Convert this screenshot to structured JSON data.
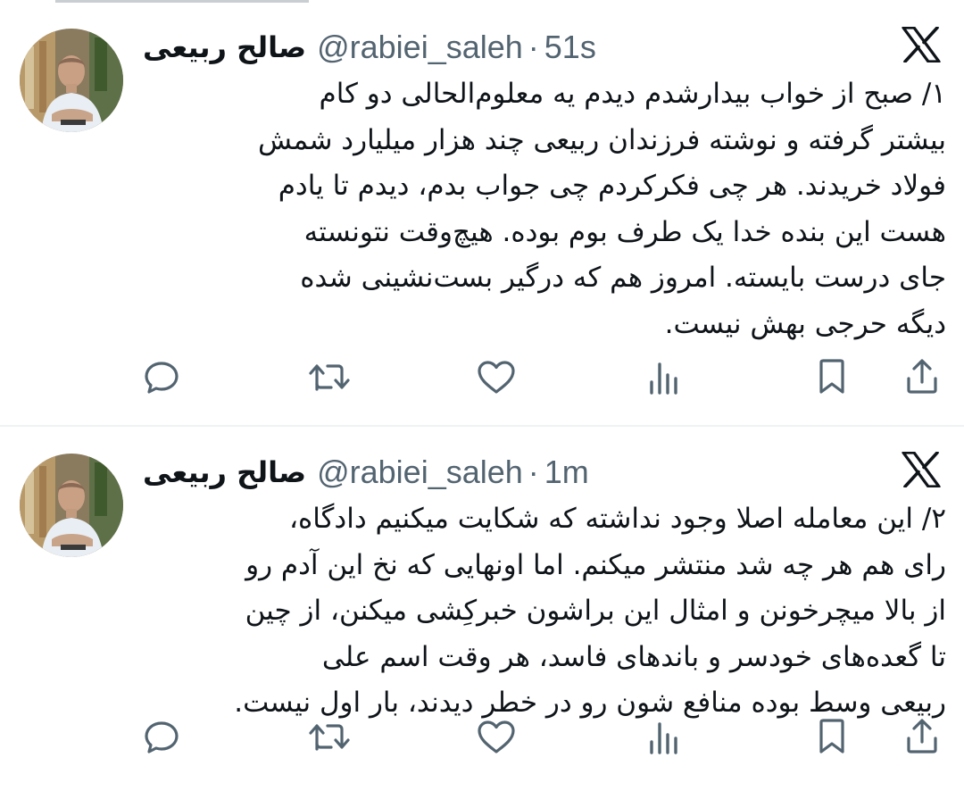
{
  "theme": {
    "text_color": "#0f1419",
    "muted_color": "#536471",
    "divider_color": "#eff3f4"
  },
  "tweets": [
    {
      "name": "صالح ربیعی",
      "handle": "@rabiei_saleh",
      "separator": "·",
      "time": "51s",
      "lines": [
        "۱/ صبح از خواب بیدارشدم دیدم یه معلوم‌الحالی دو کام",
        "بیشتر گرفته و نوشته فرزندان ربیعی چند هزار میلیارد شمش",
        "فولاد خریدند. هر چی فکرکردم چی جواب بدم، دیدم تا یادم",
        "هست این بنده خدا یک طرف بوم بوده. هیچ‌وقت نتونسته",
        "جای درست بایسته. امروز هم که درگیر بست‌نشینی شده",
        "دیگه حرجی بهش نیست."
      ]
    },
    {
      "name": "صالح ربیعی",
      "handle": "@rabiei_saleh",
      "separator": "·",
      "time": "1m",
      "lines": [
        "۲/ این معامله اصلا وجود نداشته که شکایت میکنیم دادگاه،",
        "رای هم هر چه شد منتشر میکنم. اما اونهایی که نخ این آدم رو",
        "از بالا میچرخونن و امثال این براشون خبرکِشی میکنن، از چین",
        "تا گعده‌های خودسر و باندهای فاسد، هر وقت اسم علی",
        "ربیعی وسط بوده منافع شون رو در خطر دیدند، بار اول نیست."
      ]
    }
  ],
  "icons": {
    "brand": "x-logo-icon",
    "actions": [
      "reply-icon",
      "retweet-icon",
      "like-icon",
      "views-icon",
      "bookmark-icon",
      "share-icon"
    ]
  }
}
